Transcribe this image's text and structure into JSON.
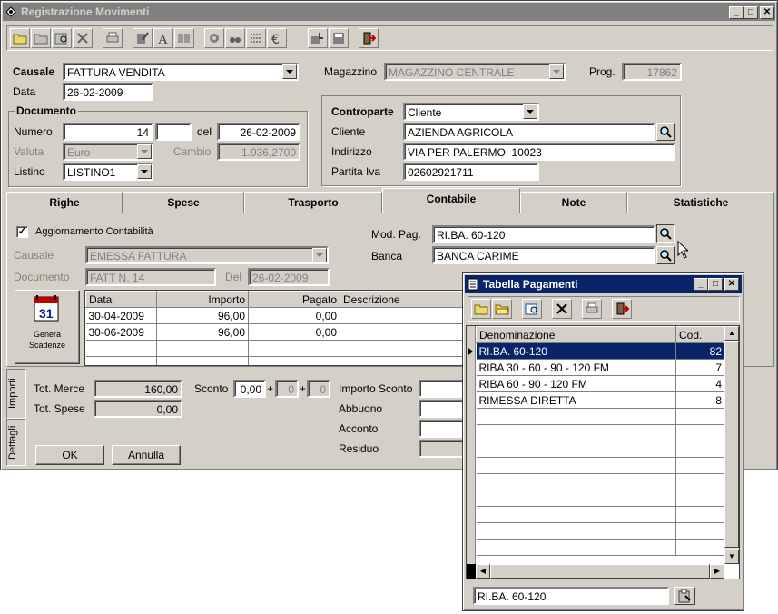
{
  "main_window": {
    "title": "Registrazione Movimenti",
    "causale": {
      "label": "Causale",
      "value": "FATTURA VENDITA"
    },
    "data": {
      "label": "Data",
      "value": "26-02-2009"
    },
    "magazzino": {
      "label": "Magazzino",
      "value": "MAGAZZINO CENTRALE"
    },
    "prog": {
      "label": "Prog.",
      "value": "17862"
    },
    "documento": {
      "title": "Documento",
      "numero_label": "Numero",
      "numero": "14",
      "numero_suffix": "",
      "del_label": "del",
      "del": "26-02-2009",
      "valuta_label": "Valuta",
      "valuta": "Euro",
      "cambio_label": "Cambio",
      "cambio": "1.936,2700",
      "listino_label": "Listino",
      "listino": "LISTINO1"
    },
    "controparte": {
      "title": "Controparte",
      "type": "Cliente",
      "cliente_label": "Cliente",
      "cliente": "AZIENDA AGRICOLA",
      "indirizzo_label": "Indirizzo",
      "indirizzo": "VIA PER PALERMO, 10023",
      "piva_label": "Partita Iva",
      "piva": "02602921711"
    },
    "tabs": [
      "Righe",
      "Spese",
      "Trasporto",
      "Contabile",
      "Note",
      "Statistiche"
    ],
    "contabile": {
      "aggiornamento_label": "Aggiornamento Contabilità",
      "aggiornamento_checked": "✓",
      "causale_label": "Causale",
      "causale": "EMESSA FATTURA",
      "documento_label": "Documento",
      "documento": "FATT N. 14",
      "del_label": "Del",
      "del": "26-02-2009",
      "mod_pag_label": "Mod. Pag.",
      "mod_pag": "RI.BA. 60-120",
      "banca_label": "Banca",
      "banca": "BANCA CARIME",
      "genera_label_1": "Genera",
      "genera_label_2": "Scadenze",
      "columns": [
        "Data",
        "Importo",
        "Pagato",
        "Descrizione"
      ],
      "rows": [
        {
          "data": "30-04-2009",
          "importo": "96,00",
          "pagato": "0,00",
          "descrizione": ""
        },
        {
          "data": "30-06-2009",
          "importo": "96,00",
          "pagato": "0,00",
          "descrizione": ""
        }
      ]
    },
    "totals": {
      "tab_importi": "Importi",
      "tab_dettagli": "Dettagli",
      "tot_merce_label": "Tot. Merce",
      "tot_merce": "160,00",
      "tot_spese_label": "Tot. Spese",
      "tot_spese": "0,00",
      "sconto_label": "Sconto",
      "sconto1": "0,00",
      "sconto2": "0",
      "sconto3": "0",
      "plus": "+",
      "importo_sconto_label": "Importo Sconto",
      "abbuono_label": "Abbuono",
      "acconto_label": "Acconto",
      "residuo_label": "Residuo"
    },
    "ok_label": "OK",
    "annulla_label": "Annulla"
  },
  "payments_window": {
    "title": "Tabella Pagamenti",
    "columns": [
      "Denominazione",
      "Cod."
    ],
    "rows": [
      {
        "name": "RI.BA. 60-120",
        "code": "82"
      },
      {
        "name": "RIBA 30 - 60 - 90 - 120  FM",
        "code": "7"
      },
      {
        "name": "RIBA 60 - 90 - 120 FM",
        "code": "4"
      },
      {
        "name": "RIMESSA DIRETTA",
        "code": "8"
      }
    ],
    "search_value": "RI.BA. 60-120",
    "selection_color": "#0a246a"
  },
  "window_buttons": {
    "minimize": "_",
    "maximize": "□",
    "close": "✕"
  }
}
